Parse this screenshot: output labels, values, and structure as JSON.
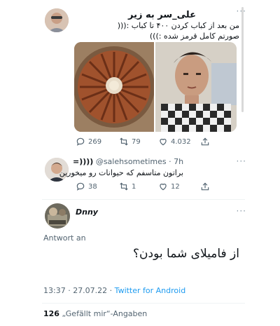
{
  "tweet1": {
    "author_name": "علی_سر به زیر",
    "text_line1": "من بعد از کباب کردن ۴۰۰ تا کباب :(((",
    "text_line2": "صورتم کامل قرمز شده :)))",
    "more_label": "···",
    "replies": "269",
    "retweets": "79",
    "likes": "4.032",
    "images": [
      "kebab-platter",
      "young-man-selfie"
    ]
  },
  "tweet2": {
    "author_name": "=))))",
    "handle_time": "@salehsometimes · 7h",
    "text": "براتون متاسفم که حیوانات رو میخورین",
    "more_label": "···",
    "replies": "38",
    "retweets": "1",
    "likes": "12"
  },
  "tweet3": {
    "author_name": "Dnny",
    "more_label": "···",
    "reply_label": "Antwort an",
    "text": "از فامیلای شما بودن؟",
    "timestamp": "13:37 · 27.07.22 ·",
    "source": "Twitter for Android",
    "likes_count": "126",
    "likes_label": "„Gefällt mir“-Angaben"
  },
  "colors": {
    "link": "#1d9bf0",
    "muted": "#536471",
    "divider": "#eff3f4"
  }
}
